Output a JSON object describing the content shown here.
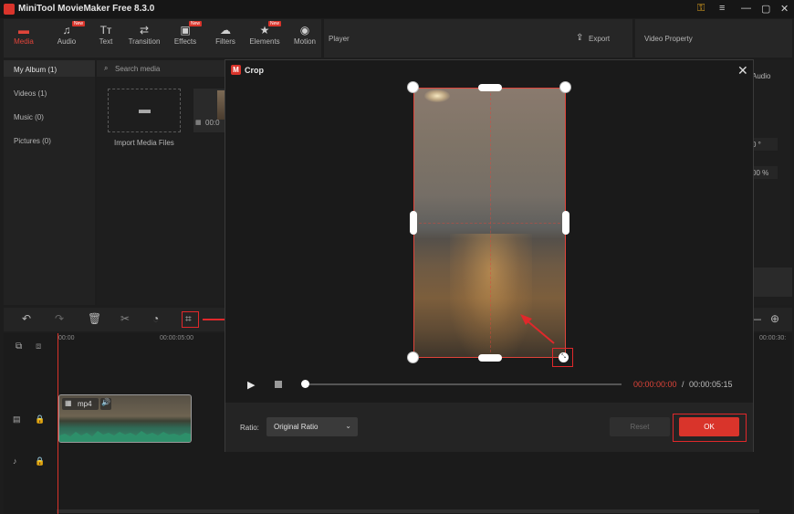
{
  "app": {
    "title": "MiniTool MovieMaker Free 8.3.0"
  },
  "toolbar": {
    "tabs": [
      {
        "label": "Media",
        "icon": "folder-icon",
        "new": false
      },
      {
        "label": "Audio",
        "icon": "music-icon",
        "new": true
      },
      {
        "label": "Text",
        "icon": "text-icon",
        "new": false
      },
      {
        "label": "Transition",
        "icon": "transition-icon",
        "new": false
      },
      {
        "label": "Effects",
        "icon": "effects-icon",
        "new": true
      },
      {
        "label": "Filters",
        "icon": "filters-icon",
        "new": false
      },
      {
        "label": "Elements",
        "icon": "elements-icon",
        "new": true
      },
      {
        "label": "Motion",
        "icon": "motion-icon",
        "new": false
      }
    ],
    "new_badge": "New"
  },
  "player": {
    "label": "Player",
    "export_label": "Export"
  },
  "property": {
    "label": "Video Property",
    "audio_tab": "Audio",
    "rotate_value": "0 °",
    "scale_value": "00 %"
  },
  "sidebar": {
    "items": [
      {
        "label": "My Album (1)"
      },
      {
        "label": "Videos (1)"
      },
      {
        "label": "Music (0)"
      },
      {
        "label": "Pictures (0)"
      }
    ]
  },
  "media": {
    "search_placeholder": "Search media",
    "import_label": "Import Media Files",
    "clip_duration": "00:0"
  },
  "timeline": {
    "ruler": [
      "00:00",
      "00:00:05:00",
      "00:00:30:"
    ],
    "clip_label": "mp4"
  },
  "crop_dialog": {
    "title": "Crop",
    "current_time": "00:00:00:00",
    "separator": "/",
    "total_time": "00:00:05:15",
    "ratio_label": "Ratio:",
    "ratio_value": "Original Ratio",
    "reset_label": "Reset",
    "ok_label": "OK"
  },
  "colors": {
    "accent": "#d9342b",
    "highlight": "#e0282b",
    "panel": "#262626",
    "background": "#1d1d1d"
  }
}
